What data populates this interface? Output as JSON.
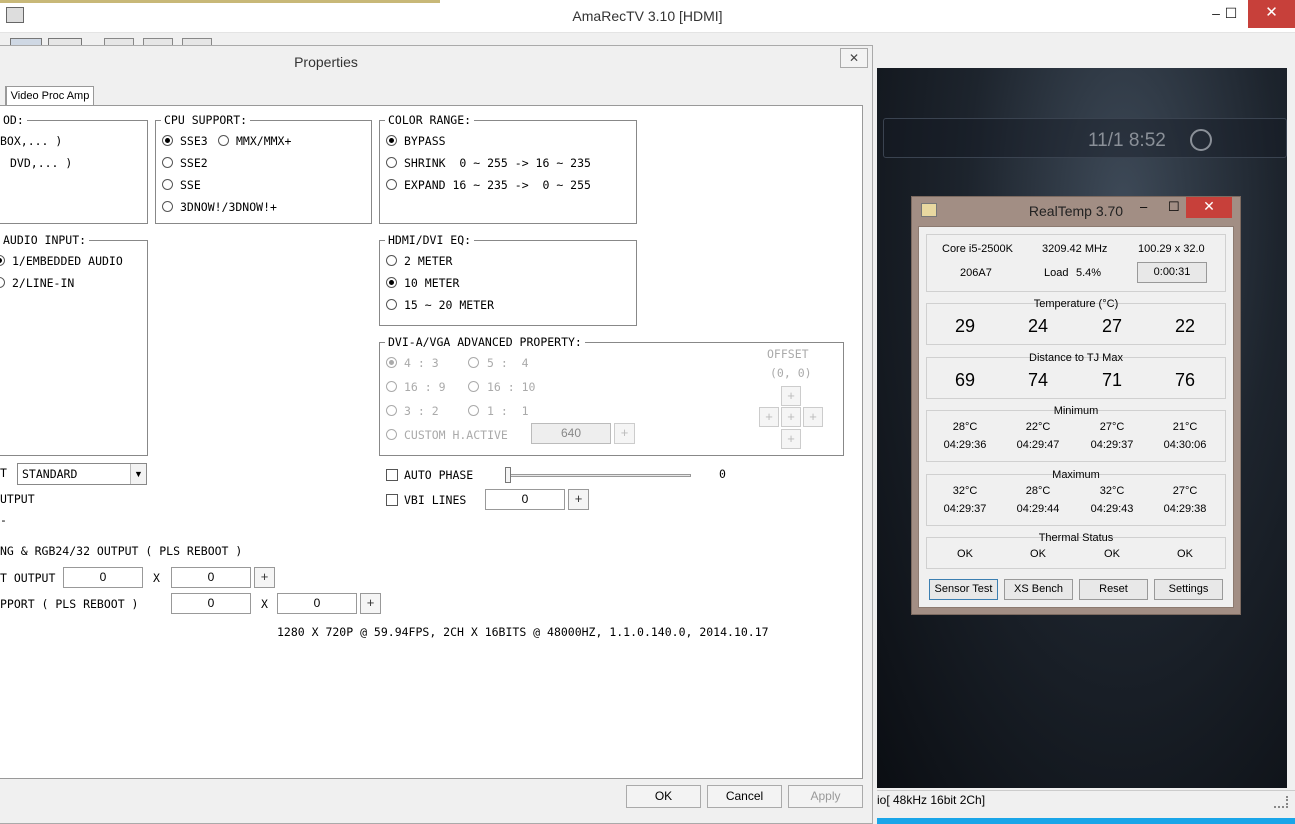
{
  "main_window": {
    "title": "AmaRecTV 3.10  [HDMI]",
    "minimize": "–",
    "maximize": "☐",
    "close": "✕",
    "status_text": "io[ 48kHz 16bit 2Ch]"
  },
  "video": {
    "clock": "11/1 8:52"
  },
  "properties": {
    "title": "Properties",
    "close": "✕",
    "tab_label": "Video Proc Amp",
    "method_group": {
      "title": "OD:",
      "options": [
        "BOX,... )",
        "DVD,... )"
      ]
    },
    "cpu_support": {
      "title": "CPU SUPPORT:",
      "options": [
        "SSE3",
        "MMX/MMX+",
        "SSE2",
        "SSE",
        "3DNOW!/3DNOW!+"
      ],
      "selected": "SSE3"
    },
    "color_range": {
      "title": "COLOR RANGE:",
      "options": [
        "BYPASS",
        "SHRINK  0 ~ 255 -> 16 ~ 235",
        "EXPAND 16 ~ 235 ->  0 ~ 255"
      ],
      "selected": "BYPASS"
    },
    "audio_input": {
      "title": "AUDIO INPUT:",
      "options": [
        "1/EMBEDDED AUDIO",
        "2/LINE-IN"
      ],
      "selected": "1/EMBEDDED AUDIO"
    },
    "hdmi_eq": {
      "title": "HDMI/DVI EQ:",
      "options": [
        "2 METER",
        "10 METER",
        "15 ~ 20 METER"
      ],
      "selected": "10 METER"
    },
    "dvi_vga": {
      "title": "DVI-A/VGA ADVANCED PROPERTY:",
      "ratio_options": [
        "4 : 3",
        "5 :  4",
        "16 : 9",
        "16 : 10",
        "3 : 2",
        "1 :  1"
      ],
      "custom_label": "CUSTOM H.ACTIVE",
      "custom_value": "640",
      "offset_label": "OFFSET",
      "offset_value": "(0, 0)"
    },
    "preset": {
      "label": "T",
      "value": "STANDARD"
    },
    "output_label": "UTPUT",
    "dash": "-",
    "auto_phase": {
      "label": "AUTO PHASE",
      "value": "0",
      "level": 0
    },
    "vbi_lines": {
      "label": "VBI LINES",
      "value": "0"
    },
    "rgb_output_label": "NG & RGB24/32 OUTPUT ( PLS REBOOT )",
    "t_output": {
      "label": "T OUTPUT",
      "x_sep": "X",
      "value1": "0",
      "value2": "0"
    },
    "support_reboot": {
      "label": "PPORT ( PLS REBOOT )",
      "x_sep": "X",
      "value1": "0",
      "value2": "0"
    },
    "info_line": "1280 X 720P @ 59.94FPS, 2CH X 16BITS @ 48000HZ, 1.1.0.140.0, 2014.10.17",
    "plus": "+",
    "buttons": {
      "ok": "OK",
      "cancel": "Cancel",
      "apply": "Apply"
    }
  },
  "realtemp": {
    "title": "RealTemp 3.70",
    "minimize": "–",
    "maximize": "☐",
    "close": "✕",
    "cpu": "Core i5-2500K",
    "freq": "3209.42 MHz",
    "multiplier": "100.29 x 32.0",
    "cpuid": "206A7",
    "load_label": "Load",
    "load_value": "5.4%",
    "timer": "0:00:31",
    "temperature": {
      "label": "Temperature (°C)",
      "values": [
        "29",
        "24",
        "27",
        "22"
      ]
    },
    "distance": {
      "label": "Distance to TJ Max",
      "values": [
        "69",
        "74",
        "71",
        "76"
      ]
    },
    "minimum": {
      "label": "Minimum",
      "temps": [
        "28°C",
        "22°C",
        "27°C",
        "21°C"
      ],
      "times": [
        "04:29:36",
        "04:29:47",
        "04:29:37",
        "04:30:06"
      ]
    },
    "maximum": {
      "label": "Maximum",
      "temps": [
        "32°C",
        "28°C",
        "32°C",
        "27°C"
      ],
      "times": [
        "04:29:37",
        "04:29:44",
        "04:29:43",
        "04:29:38"
      ]
    },
    "thermal": {
      "label": "Thermal Status",
      "values": [
        "OK",
        "OK",
        "OK",
        "OK"
      ]
    },
    "buttons": {
      "sensor_test": "Sensor Test",
      "xs_bench": "XS Bench",
      "reset": "Reset",
      "settings": "Settings"
    }
  }
}
